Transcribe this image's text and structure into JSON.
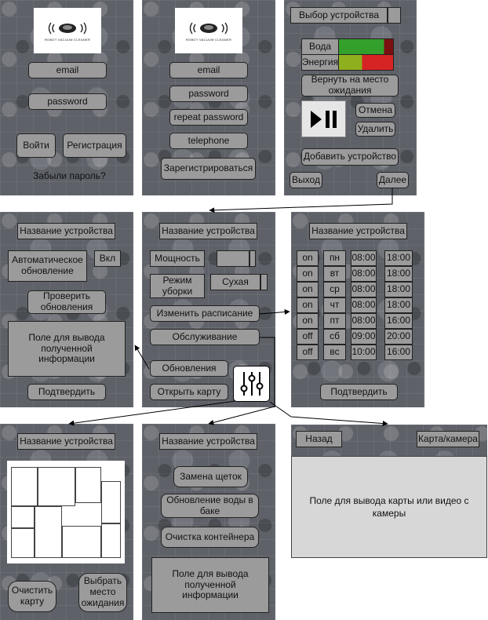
{
  "login": {
    "logo_text": "ROBOT VACUUM CLEANER",
    "email": "email",
    "password": "password",
    "login": "Войти",
    "register": "Регистрация",
    "forgot": "Забыли пароль?"
  },
  "signup": {
    "logo_text": "ROBOT VACUUM CLEANER",
    "email": "email",
    "password": "password",
    "repeat": "repeat password",
    "phone": "telephone",
    "submit": "Зарегистрироваться"
  },
  "main": {
    "device_select": "Выбор устройства",
    "water": "Вода",
    "energy": "Энергия",
    "return": "Вернуть на место ожидания",
    "cancel": "Отмена",
    "delete": "Удалить",
    "add": "Добавить устройство",
    "exit": "Выход",
    "next": "Далее",
    "play_pause_icon": "play-pause-icon",
    "water_level_color": "#33a02c",
    "energy_level_colors": [
      "#8fb01e",
      "#d62424"
    ]
  },
  "update": {
    "title": "Название устройства",
    "auto": "Автоматическое обновление",
    "toggle": "Вкл",
    "check": "Проверить обновления",
    "output": "Поле для вывода полученной информации",
    "confirm": "Подтвердить"
  },
  "settings": {
    "title": "Название устройства",
    "power": "Мощность",
    "mode": "Режим уборки",
    "mode_value": "Сухая",
    "schedule": "Изменить расписание",
    "service": "Обслуживание",
    "updates": "Обновления",
    "map": "Открыть карту",
    "sliders_icon": "sliders-icon"
  },
  "schedule": {
    "title": "Название устройства",
    "rows": [
      [
        "on",
        "пн",
        "08:00",
        "18:00"
      ],
      [
        "on",
        "вт",
        "08:00",
        "18:00"
      ],
      [
        "on",
        "ср",
        "08:00",
        "18:00"
      ],
      [
        "on",
        "чт",
        "08:00",
        "18:00"
      ],
      [
        "on",
        "пт",
        "08:00",
        "16:00"
      ],
      [
        "off",
        "сб",
        "09:00",
        "20:00"
      ],
      [
        "off",
        "вс",
        "10:00",
        "16:00"
      ]
    ],
    "confirm": "Подтвердить"
  },
  "mapview": {
    "title": "Название устройства",
    "clear": "Очистить карту",
    "wait": "Выбрать место ожидания"
  },
  "service": {
    "title": "Название устройства",
    "brushes": "Замена щеток",
    "water": "Обновление воды в баке",
    "container": "Очистка контейнера",
    "output": "Поле для вывода полученной информации"
  },
  "camera": {
    "back": "Назад",
    "toggle": "Карта/камера",
    "output": "Поле для вывода карты или видео с камеры"
  }
}
